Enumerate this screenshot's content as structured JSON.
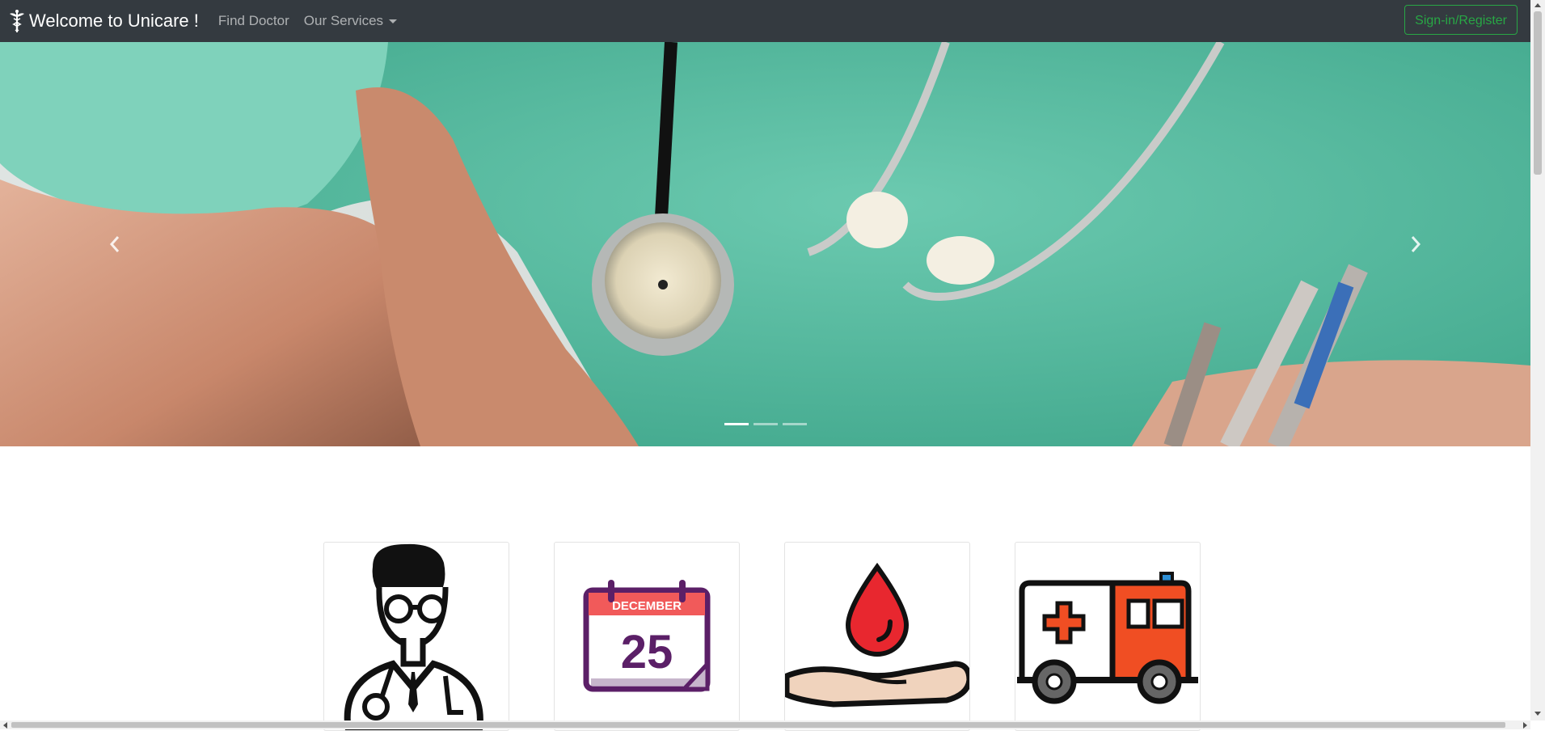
{
  "navbar": {
    "brand": "Welcome to Unicare !",
    "brand_icon": "caduceus-icon",
    "links": [
      {
        "label": "Find Doctor"
      },
      {
        "label": "Our Services",
        "dropdown": true
      }
    ],
    "signin_label": "Sign-in/Register",
    "signin_color": "#28a745",
    "background": "#343a40"
  },
  "carousel": {
    "slide_count": 3,
    "active_index": 0,
    "slide_image": "doctor-in-green-scrubs-with-stethoscope"
  },
  "cards": [
    {
      "icon": "doctor-icon"
    },
    {
      "icon": "calendar-icon",
      "month": "DECEMBER",
      "day": "25"
    },
    {
      "icon": "blood-donation-icon"
    },
    {
      "icon": "ambulance-icon"
    }
  ]
}
